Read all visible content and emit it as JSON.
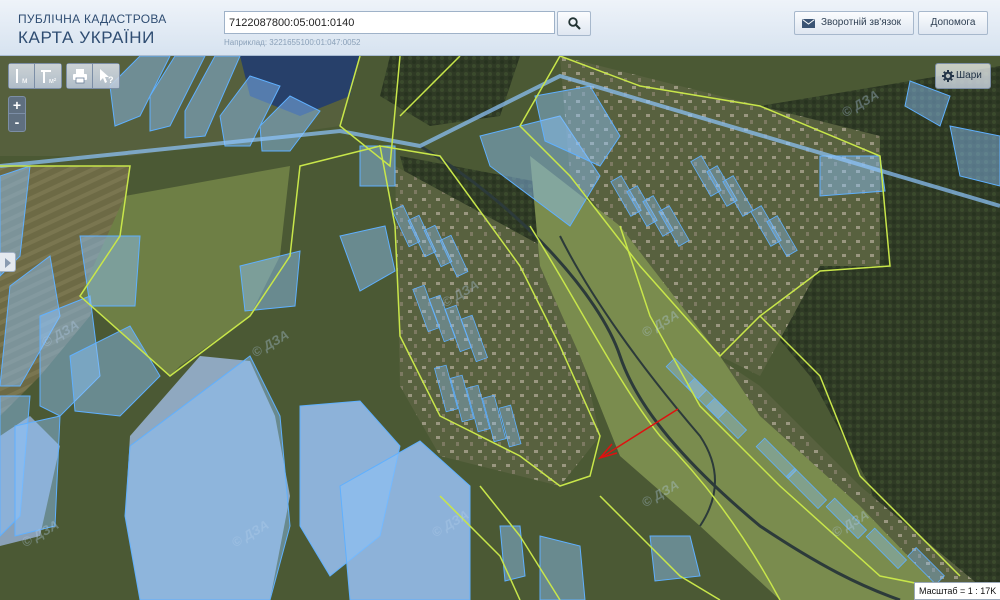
{
  "header": {
    "brand_line1": "ПУБЛІЧНА КАДАСТРОВА",
    "brand_line2": "КАРТА УКРАЇНИ",
    "search_value": "7122087800:05:001:0140",
    "search_hint": "Наприклад: 3221655100:01:047:0052",
    "feedback_label": "Зворотній зв'язок",
    "help_label": "Допомога"
  },
  "controls": {
    "tools": [
      "ruler-length-icon",
      "ruler-area-icon",
      "print-icon",
      "info-pointer-icon"
    ],
    "zoom_in": "+",
    "zoom_out": "-",
    "layers_label": "Шари"
  },
  "map": {
    "scale_label": "Масштаб = 1 : 17K",
    "watermark": "© ДЗА",
    "colors": {
      "parcel_fill": "#8ec6ff",
      "parcel_stroke": "#5fb0ff",
      "boundary_line": "#c8e64a",
      "marker_arrow": "#e01010",
      "river": "#2c3a3a"
    }
  }
}
